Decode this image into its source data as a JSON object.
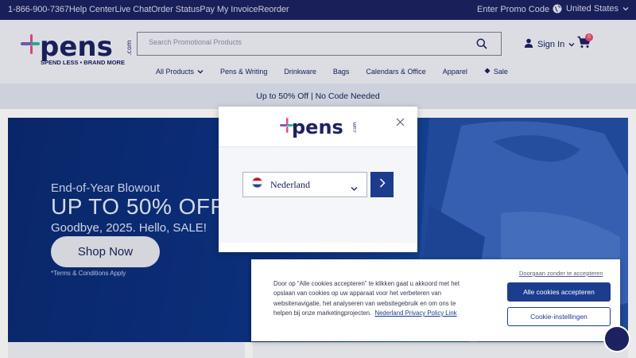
{
  "topbar": {
    "phone": "1-866-900-7367",
    "help": "Help Center",
    "chat": "Live Chat",
    "order_status": "Order Status",
    "pay_invoice": "Pay My Invoice",
    "reorder": "Reorder",
    "promo_code": "Enter Promo Code",
    "region": "United States"
  },
  "header": {
    "logo_text": "pens",
    "logo_suffix": ".com",
    "logo_tagline": "SPEND LESS • BRAND MORE",
    "search_placeholder": "Search Promotional Products",
    "signin": "Sign In",
    "cart_count": "0"
  },
  "nav": {
    "items": [
      "All Products",
      "Pens & Writing",
      "Drinkware",
      "Bags",
      "Calendars & Office",
      "Apparel",
      "Sale"
    ]
  },
  "promo_strip": "Up to 50% Off | No Code Needed",
  "hero": {
    "eyebrow": "End-of-Year Blowout",
    "headline": "UP TO 50% OFF",
    "subline": "Goodbye, 2025. Hello, SALE!",
    "cta": "Shop Now",
    "terms": "*Terms & Conditions Apply"
  },
  "modal": {
    "country": "Nederland"
  },
  "cookie": {
    "text": "Door op “Alle cookies accepteren” te klikken gaat u akkoord met het opslaan van cookies op uw apparaat voor het verbeteren van websitenavigatie, het analyseren van websitegebruik en om ons te helpen bij onze marketingprojecten.",
    "policy_link": "Nederland Privacy Policy Link",
    "reject": "Doorgaan zonder te accepteren",
    "accept": "Alle cookies accepteren",
    "settings": "Cookie-instellingen"
  },
  "colors": {
    "navy": "#1c2261",
    "button_blue": "#1c3c8e",
    "hero_blue": "#0d3487"
  }
}
